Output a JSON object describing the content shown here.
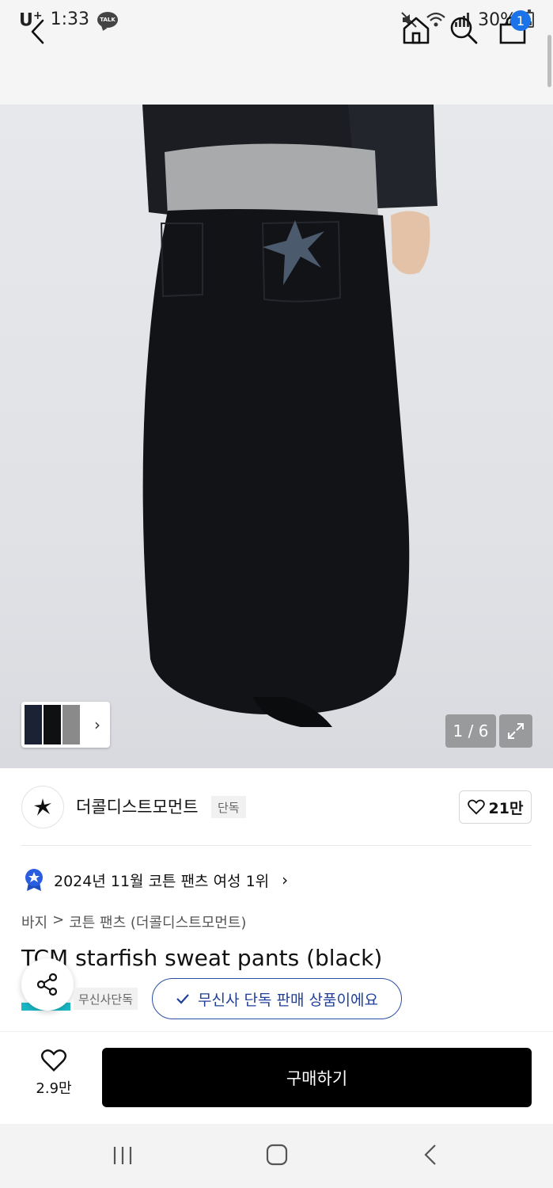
{
  "status_bar": {
    "carrier": "U",
    "carrier_sup": "+",
    "time": "1:33",
    "talk_icon_text": "TALK",
    "battery": "30%"
  },
  "header": {
    "icons": [
      "back-chevron-icon",
      "home-icon",
      "search-icon",
      "shopping-bag-icon"
    ],
    "cart_count": "1"
  },
  "gallery": {
    "counter": "1 / 6",
    "thumb_chevron": "›",
    "hero_colors": {
      "background": "#e1e3e7",
      "pants": "#121316",
      "jacket": "#1b1d22",
      "sweater": "#a9aaac",
      "starfish": "#4b5a6c",
      "skin": "#e3c2a8"
    }
  },
  "brand": {
    "name": "더콜디스트모먼트",
    "exclusive_tag": "단독",
    "likes": "21만"
  },
  "ranking": {
    "text": "2024년 11월 코튼 팬츠 여성 1위",
    "chevron": "›"
  },
  "breadcrumb": [
    "바지",
    ">",
    "코튼 팬츠 (더콜디스트모먼트)"
  ],
  "product": {
    "title": "TCM starfish sweat pants (black)",
    "store_tag": "무신사단독",
    "verify_text": "무신사 단독 판매 상품이에요"
  },
  "bottom": {
    "favorite_count": "2.9만",
    "buy_label": "구매하기"
  },
  "colors": {
    "accent_blue": "#1a73e8",
    "verify_blue": "#2b4fa3",
    "teal": "#1ab8c5",
    "buy_button": "#000000"
  }
}
